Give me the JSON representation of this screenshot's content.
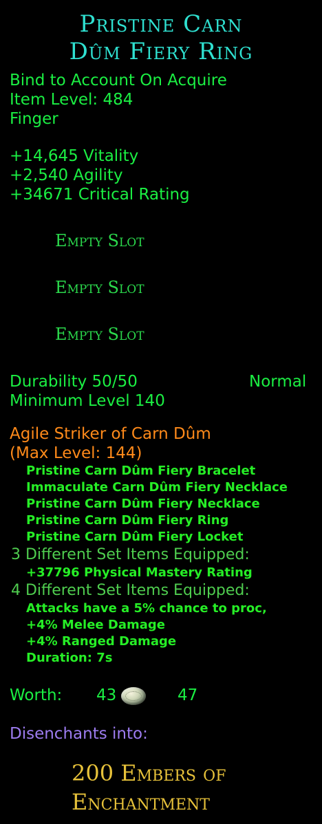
{
  "item": {
    "name_line1": "Pristine Carn",
    "name_line2": "Dûm Fiery Ring",
    "bind": "Bind to Account On Acquire",
    "item_level": "Item Level: 484",
    "slot": "Finger"
  },
  "stats": {
    "vitality": "+14,645 Vitality",
    "agility": "+2,540 Agility",
    "critical": "+34671 Critical Rating"
  },
  "essence_slots": [
    "Empty Slot",
    "Empty Slot",
    "Empty Slot"
  ],
  "durability": {
    "value": "Durability 50/50",
    "type": "Normal"
  },
  "min_level": "Minimum Level 140",
  "set": {
    "name": "Agile Striker of Carn Dûm",
    "max_level": "(Max Level: 144)",
    "items": [
      "Pristine Carn Dûm Fiery Bracelet",
      "Immaculate Carn Dûm Fiery Necklace",
      "Pristine Carn Dûm Fiery Necklace",
      "Pristine Carn Dûm Fiery Ring",
      "Pristine Carn Dûm Fiery Locket"
    ],
    "bonus3_header": "3 Different Set Items Equipped:",
    "bonus3": [
      "+37796 Physical Mastery Rating"
    ],
    "bonus4_header": "4 Different Set Items Equipped:",
    "bonus4": [
      "Attacks have a 5% chance to proc,",
      "+4% Melee Damage",
      "+4% Ranged Damage",
      "Duration: 7s"
    ]
  },
  "worth": {
    "label": "Worth:",
    "gold": "43",
    "silver": "47",
    "coin_icon": "silver-coin-icon"
  },
  "disenchant": {
    "label": "Disenchants into:",
    "line1": "200 Embers of",
    "line2": "Enchantment"
  },
  "colors": {
    "title": "#2fe0d0",
    "stat_green": "#1bef43",
    "set_orange": "#ff8a1a",
    "disenchant_purple": "#9d7cf0",
    "result_gold": "#e6c13a"
  }
}
